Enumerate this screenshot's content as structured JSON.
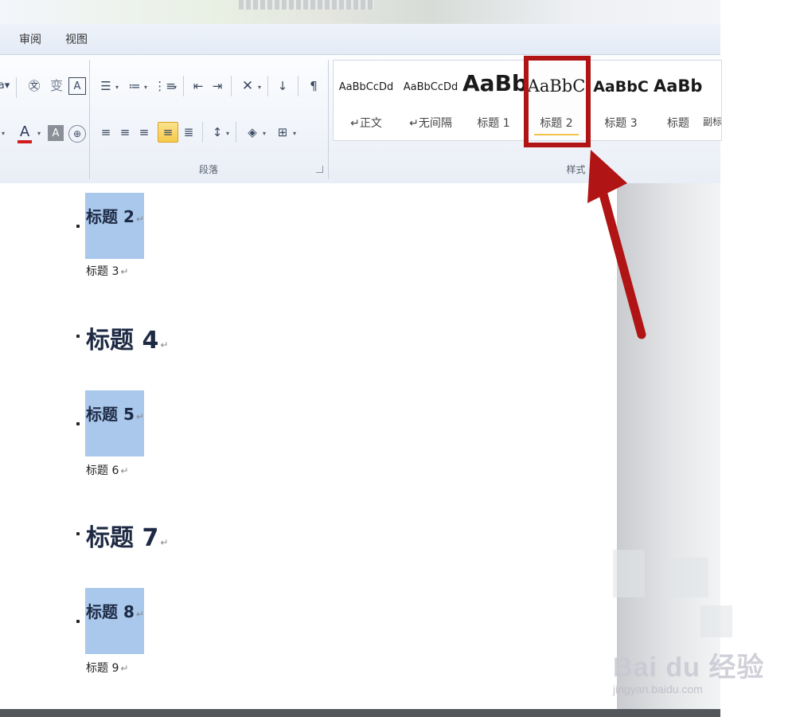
{
  "tabs": [
    "审阅",
    "视图"
  ],
  "ribbon": {
    "font_group": {
      "text_color": "#d01c1c"
    },
    "paragraph_group": {
      "label": "段落"
    },
    "styles_group": {
      "label": "样式",
      "items": [
        {
          "sample": "AaBbCcDd",
          "name": "↵正文"
        },
        {
          "sample": "AaBbCcDd",
          "name": "↵无间隔"
        },
        {
          "sample": "AaBb",
          "name": "标题 1"
        },
        {
          "sample": "AaBbC",
          "name": "标题 2"
        },
        {
          "sample": "AaBbC",
          "name": "标题 3"
        },
        {
          "sample": "AaBbB",
          "name": "标题"
        },
        {
          "sample": "",
          "name": "副标"
        }
      ]
    }
  },
  "document": {
    "headings": [
      {
        "text": "标题 2",
        "mark": "↵"
      },
      {
        "text": "标题 3",
        "mark": "↵"
      },
      {
        "text": "标题 4",
        "mark": "↵"
      },
      {
        "text": "标题 5",
        "mark": "↵"
      },
      {
        "text": "标题 6",
        "mark": "↵"
      },
      {
        "text": "标题 7",
        "mark": "↵"
      },
      {
        "text": "标题 8",
        "mark": "↵"
      },
      {
        "text": "标题 9",
        "mark": "↵"
      }
    ]
  },
  "watermark": {
    "logo": "Bai du 经验",
    "url": "jingyan.baidu.com"
  },
  "colors": {
    "highlight": "#a9c8ec",
    "callout": "#b01414",
    "active_button": "#f6c94b"
  }
}
